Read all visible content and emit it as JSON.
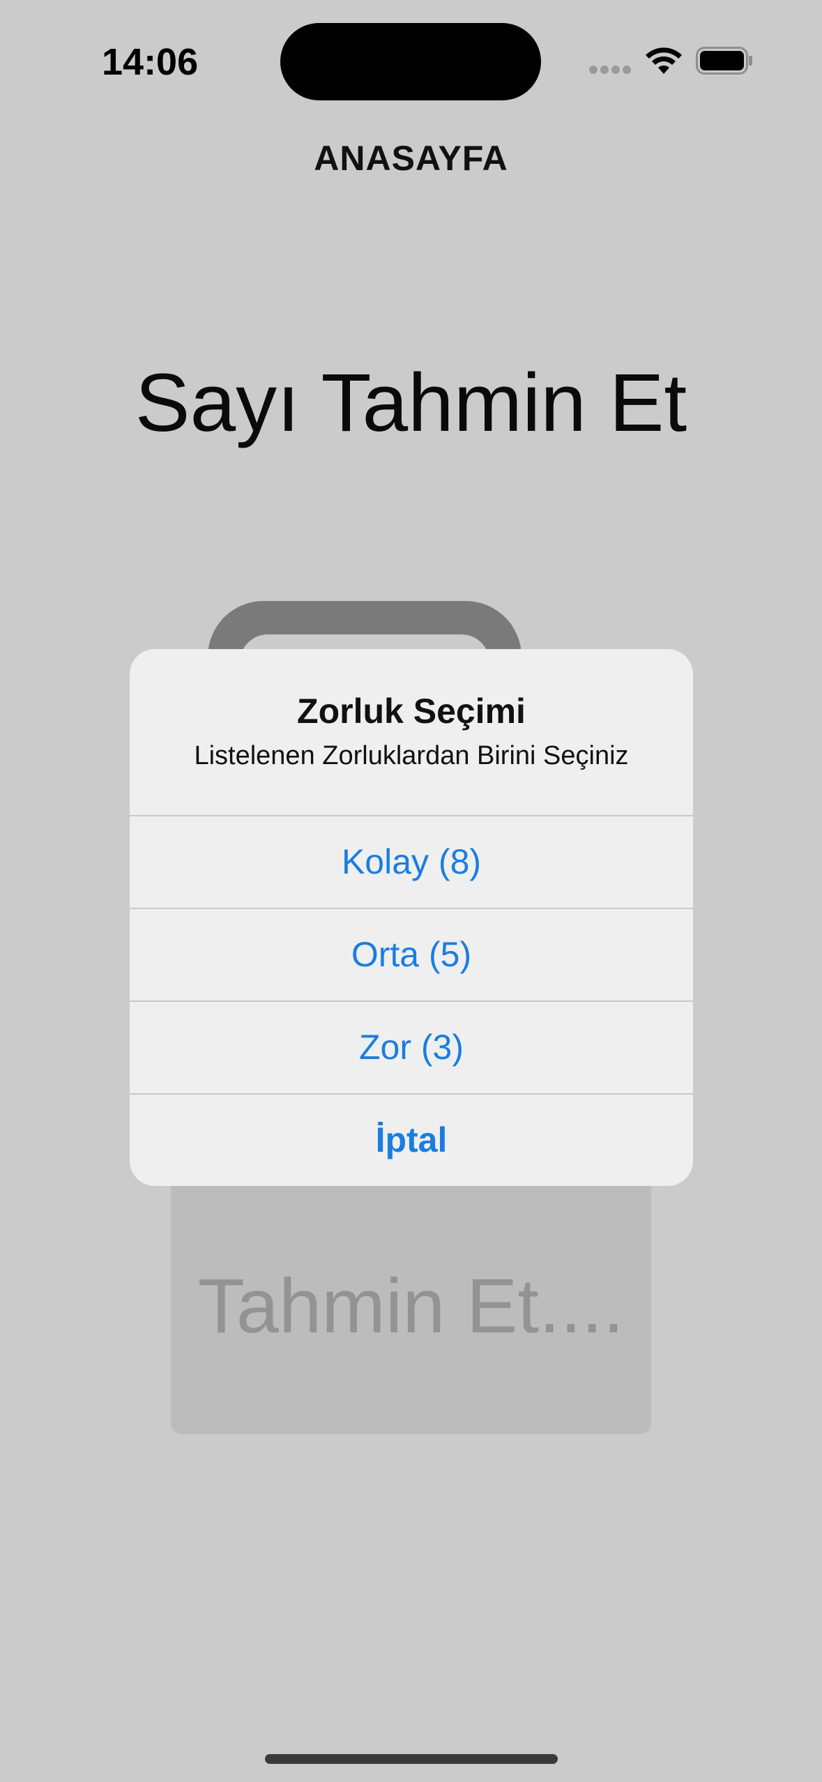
{
  "status_bar": {
    "time": "14:06",
    "icons": [
      "signal-dots-icon",
      "wifi-icon",
      "battery-icon"
    ]
  },
  "nav": {
    "title": "ANASAYFA"
  },
  "main": {
    "title": "Sayı Tahmin Et",
    "background_button_label": "Tahmin Et...."
  },
  "alert": {
    "title": "Zorluk Seçimi",
    "message": "Listelenen Zorluklardan Birini Seçiniz",
    "actions": [
      {
        "label": "Kolay (8)"
      },
      {
        "label": "Orta (5)"
      },
      {
        "label": "Zor (3)"
      }
    ],
    "cancel_label": "İptal"
  },
  "colors": {
    "background": "#cbcbcb",
    "alert_background": "#efefef",
    "action_tint": "#1a7ddf"
  }
}
